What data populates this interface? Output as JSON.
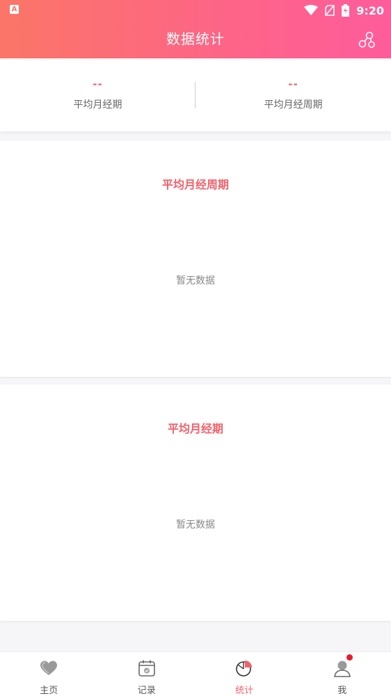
{
  "status_bar": {
    "app_icon_letter": "A",
    "time": "9:20"
  },
  "header": {
    "title": "数据统计"
  },
  "summary": {
    "left": {
      "value": "--",
      "label": "平均月经期"
    },
    "right": {
      "value": "--",
      "label": "平均月经周期"
    }
  },
  "cards": [
    {
      "title": "平均月经周期",
      "empty_text": "暂无数据"
    },
    {
      "title": "平均月经期",
      "empty_text": "暂无数据"
    }
  ],
  "tabbar": {
    "items": [
      {
        "label": "主页",
        "icon": "heart-icon",
        "active": false
      },
      {
        "label": "记录",
        "icon": "calendar-icon",
        "active": false
      },
      {
        "label": "统计",
        "icon": "pie-chart-icon",
        "active": true
      },
      {
        "label": "我",
        "icon": "user-icon",
        "active": false,
        "badge": true
      }
    ]
  },
  "colors": {
    "header_gradient_start": "#fb7667",
    "header_gradient_end": "#ff5c9c",
    "accent": "#f2606a",
    "badge": "#e81c2c"
  }
}
